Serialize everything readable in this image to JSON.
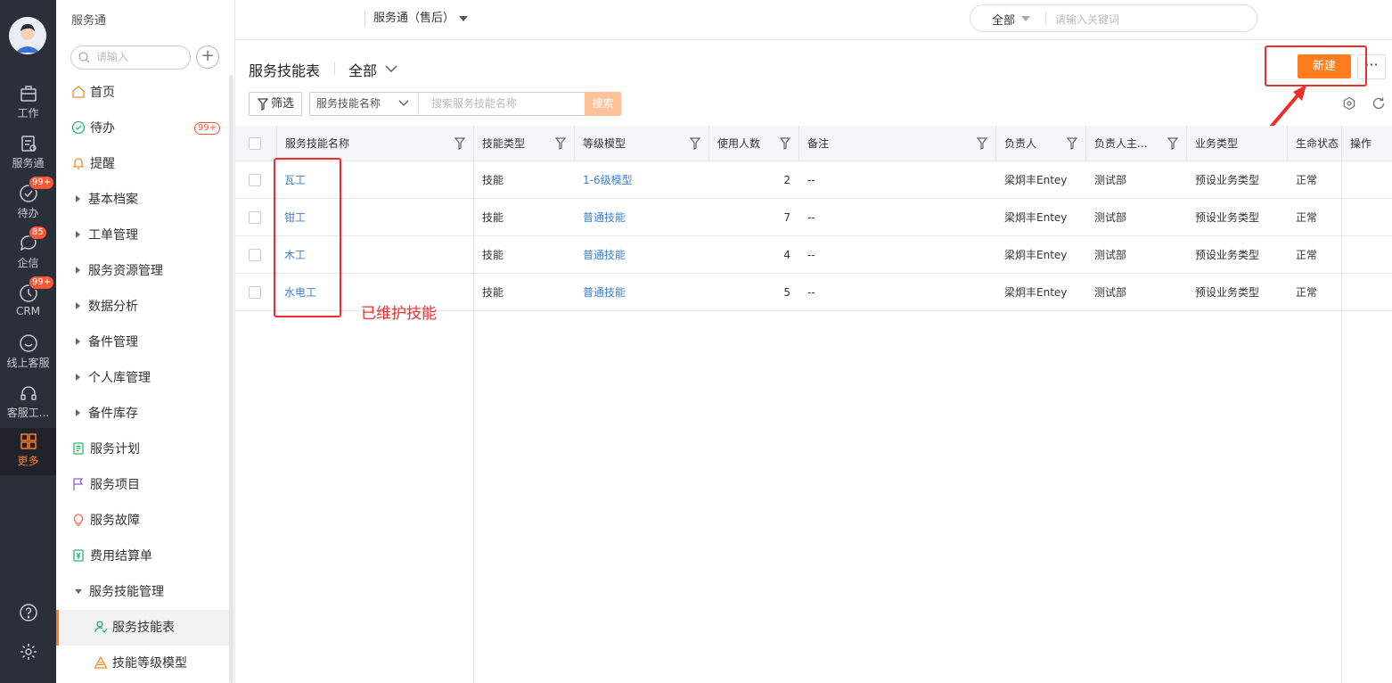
{
  "rail": {
    "items": [
      {
        "label": "工作",
        "icon": "briefcase-icon"
      },
      {
        "label": "服务通",
        "icon": "service-doc-icon"
      },
      {
        "label": "待办",
        "icon": "check-circle-icon",
        "badge": "99+"
      },
      {
        "label": "企信",
        "icon": "chat-icon",
        "badge": "85"
      },
      {
        "label": "CRM",
        "icon": "clock-icon",
        "badge": "99+"
      },
      {
        "label": "线上客服",
        "icon": "smile-icon"
      },
      {
        "label": "客服工...",
        "icon": "headset-icon"
      },
      {
        "label": "更多",
        "icon": "grid-icon",
        "active": true
      }
    ],
    "bottom": [
      {
        "icon": "help-icon"
      },
      {
        "icon": "settings-icon"
      }
    ]
  },
  "sidebar": {
    "title": "服务通",
    "search_placeholder": "请输入",
    "items": [
      {
        "label": "首页",
        "type": "icon",
        "icon": "home-icon",
        "color": "#f08c2a"
      },
      {
        "label": "待办",
        "type": "icon",
        "icon": "check-circle-icon",
        "color": "#2cb56b",
        "badge": "99+"
      },
      {
        "label": "提醒",
        "type": "icon",
        "icon": "bell-icon",
        "color": "#f08c2a"
      },
      {
        "label": "基本档案",
        "type": "group"
      },
      {
        "label": "工单管理",
        "type": "group"
      },
      {
        "label": "服务资源管理",
        "type": "group"
      },
      {
        "label": "数据分析",
        "type": "group"
      },
      {
        "label": "备件管理",
        "type": "group"
      },
      {
        "label": "个人库管理",
        "type": "group"
      },
      {
        "label": "备件库存",
        "type": "group"
      },
      {
        "label": "服务计划",
        "type": "icon",
        "icon": "plan-icon",
        "color": "#2cb56b"
      },
      {
        "label": "服务项目",
        "type": "icon",
        "icon": "flag-icon",
        "color": "#8a5fd6"
      },
      {
        "label": "服务故障",
        "type": "icon",
        "icon": "bulb-icon",
        "color": "#f26b4a"
      },
      {
        "label": "费用结算单",
        "type": "icon",
        "icon": "invoice-icon",
        "color": "#2cb56b"
      },
      {
        "label": "服务技能管理",
        "type": "group-open"
      },
      {
        "label": "服务技能表",
        "type": "sub",
        "icon": "skill-user-icon",
        "color": "#2cb56b",
        "selected": true
      },
      {
        "label": "技能等级模型",
        "type": "sub",
        "icon": "triangle-icon",
        "color": "#f08c2a"
      }
    ]
  },
  "topbar": {
    "app_selector": "服务通（售后）",
    "search_scope": "全部",
    "search_placeholder": "请输入关键词"
  },
  "content": {
    "title": "服务技能表",
    "view": "全部",
    "new_button": "新建",
    "more_button": "···",
    "filter_button": "筛选",
    "field_select": "服务技能名称",
    "search_placeholder": "搜索服务技能名称",
    "search_button": "搜索",
    "annotation": "已维护技能"
  },
  "table": {
    "columns": [
      "服务技能名称",
      "技能类型",
      "等级模型",
      "使用人数",
      "备注",
      "负责人",
      "负责人主...",
      "业务类型",
      "生命状态",
      "操作"
    ],
    "rows": [
      {
        "name": "瓦工",
        "type": "技能",
        "model": "1-6级模型",
        "count": "2",
        "note": "--",
        "owner": "梁炯丰Entey",
        "dept": "测试部",
        "biz": "预设业务类型",
        "state": "正常"
      },
      {
        "name": "钳工",
        "type": "技能",
        "model": "普通技能",
        "count": "7",
        "note": "--",
        "owner": "梁炯丰Entey",
        "dept": "测试部",
        "biz": "预设业务类型",
        "state": "正常"
      },
      {
        "name": "木工",
        "type": "技能",
        "model": "普通技能",
        "count": "4",
        "note": "--",
        "owner": "梁炯丰Entey",
        "dept": "测试部",
        "biz": "预设业务类型",
        "state": "正常"
      },
      {
        "name": "水电工",
        "type": "技能",
        "model": "普通技能",
        "count": "5",
        "note": "--",
        "owner": "梁炯丰Entey",
        "dept": "测试部",
        "biz": "预设业务类型",
        "state": "正常"
      }
    ]
  },
  "colors": {
    "accent": "#ff7d1e",
    "link": "#3b7fd6",
    "annotation": "#ee2d2d",
    "rail": "#2b2f3a"
  }
}
